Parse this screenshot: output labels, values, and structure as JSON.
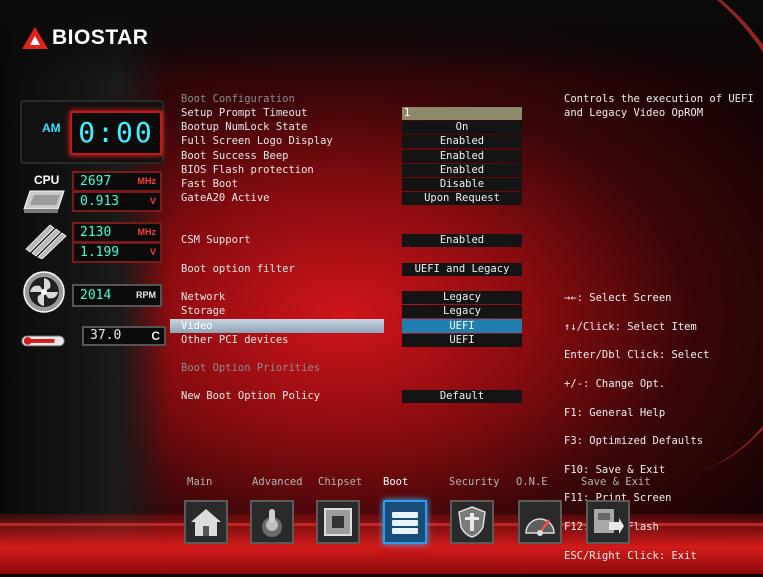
{
  "brand": {
    "logo_text": "BIOSTAR"
  },
  "status": {
    "clock_ampm": "AM",
    "clock_time": "0:00",
    "cpu_label": "CPU",
    "cpu_freq": "2697",
    "cpu_freq_unit": "MHz",
    "cpu_volt": "0.913",
    "cpu_volt_unit": "V",
    "mem_freq": "2130",
    "mem_freq_unit": "MHz",
    "mem_volt": "1.199",
    "mem_volt_unit": "V",
    "fan_rpm": "2014",
    "fan_rpm_unit": "RPM",
    "temp": "37.0",
    "temp_unit": "C"
  },
  "menu": {
    "boot_configuration_header": "Boot Configuration",
    "setup_prompt_timeout": {
      "label": "Setup Prompt Timeout",
      "value": "1"
    },
    "bootup_numlock_state": {
      "label": "Bootup NumLock State",
      "value": "On"
    },
    "full_screen_logo": {
      "label": "Full Screen Logo Display",
      "value": "Enabled"
    },
    "boot_success_beep": {
      "label": "Boot Success Beep",
      "value": "Enabled"
    },
    "bios_flash_protection": {
      "label": "BIOS Flash protection",
      "value": "Enabled"
    },
    "fast_boot": {
      "label": "Fast Boot",
      "value": "Disable"
    },
    "gatea20_active": {
      "label": "GateA20 Active",
      "value": "Upon Request"
    },
    "csm_support": {
      "label": "CSM Support",
      "value": "Enabled"
    },
    "boot_option_filter": {
      "label": "Boot option filter",
      "value": "UEFI and Legacy"
    },
    "network": {
      "label": "Network",
      "value": "Legacy"
    },
    "storage": {
      "label": "Storage",
      "value": "Legacy"
    },
    "video": {
      "label": "Video",
      "value": "UEFI"
    },
    "other_pci": {
      "label": "Other PCI devices",
      "value": "UEFI"
    },
    "boot_option_priorities_header": "Boot Option Priorities",
    "new_boot_option_policy": {
      "label": "New Boot Option Policy",
      "value": "Default"
    }
  },
  "help": {
    "description": "Controls the execution of UEFI and Legacy Video OpROM",
    "keys": [
      "→←: Select Screen",
      "↑↓/Click: Select Item",
      "Enter/Dbl Click: Select",
      "+/-: Change Opt.",
      "F1: General Help",
      "F3: Optimized Defaults",
      "F10: Save & Exit",
      "F11: Print Screen",
      "F12: BIOS Flash",
      "ESC/Right Click: Exit"
    ]
  },
  "tabs": {
    "main": "Main",
    "advanced": "Advanced",
    "chipset": "Chipset",
    "boot": "Boot",
    "security": "Security",
    "one": "O.N.E",
    "save_exit": "Save & Exit"
  },
  "colors": {
    "accent_red": "#e1221d",
    "lcd_cyan": "#3ef2ff",
    "selected_value": "#1f7fb0",
    "active_tab_border": "#2a9ee8"
  }
}
